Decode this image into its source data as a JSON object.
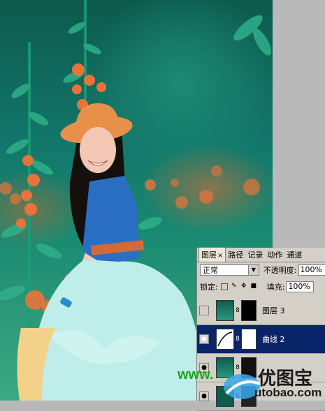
{
  "layers_panel": {
    "tabs": [
      {
        "label": "图层",
        "active": true,
        "close": "×"
      },
      {
        "label": "路径",
        "active": false
      },
      {
        "label": "记录",
        "active": false
      },
      {
        "label": "动作",
        "active": false
      },
      {
        "label": "通道",
        "active": false
      }
    ],
    "blend_mode": "正常",
    "opacity_label": "不透明度:",
    "opacity_value": "100%",
    "lock_label": "锁定:",
    "fill_label": "填充:",
    "fill_value": "100%",
    "layers": [
      {
        "name": "图层 3",
        "visible": false,
        "selected": false
      },
      {
        "name": "曲线 2",
        "visible": true,
        "selected": true
      },
      {
        "name": "",
        "visible": true,
        "selected": false
      },
      {
        "name": "",
        "visible": true,
        "selected": false
      }
    ]
  },
  "watermark": {
    "left_text": "www.",
    "brand": "优图宝",
    "domain": "utobao.com"
  },
  "colors": {
    "teal_bg": "#12766a",
    "orange_flower": "#e8733a",
    "hat": "#e8904a",
    "dress_blue": "#2a6fc4",
    "skirt": "#bfeeea",
    "selection": "#0a246a"
  }
}
